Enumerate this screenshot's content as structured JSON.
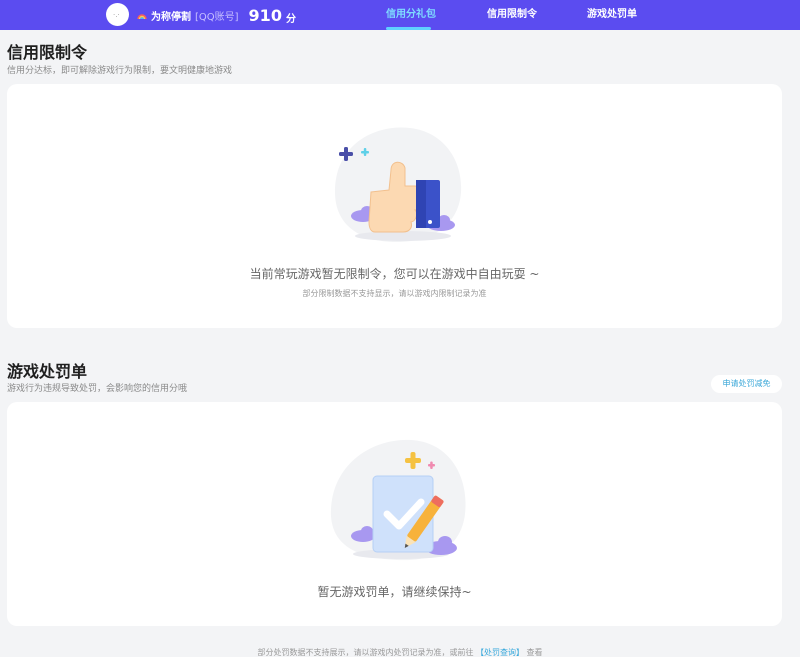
{
  "header": {
    "nickname": "为称停割",
    "account_label": "[QQ账号]",
    "score": "910",
    "score_unit": "分",
    "tabs": [
      {
        "label": "信用分礼包",
        "active": true
      },
      {
        "label": "信用限制令",
        "active": false
      },
      {
        "label": "游戏处罚单",
        "active": false
      }
    ]
  },
  "restriction": {
    "title": "信用限制令",
    "desc": "信用分达标，即可解除游戏行为限制，要文明健康地游戏",
    "empty_main": "当前常玩游戏暂无限制令，您可以在游戏中自由玩耍 ~",
    "empty_sub": "部分限制数据不支持显示，请以游戏内限制记录为准"
  },
  "penalty": {
    "title": "游戏处罚单",
    "desc": "游戏行为违规导致处罚，会影响您的信用分哦",
    "appeal_button": "申请处罚减免",
    "empty_main": "暂无游戏罚单，请继续保持~"
  },
  "footer": {
    "text_before": "部分处罚数据不支持展示，请以游戏内处罚记录为准，或前往",
    "link": "【处罚查询】",
    "text_after": "查看"
  },
  "colors": {
    "header_bg": "#5b4cf0",
    "active_tab": "#7fdcff",
    "link": "#38a9dc"
  }
}
